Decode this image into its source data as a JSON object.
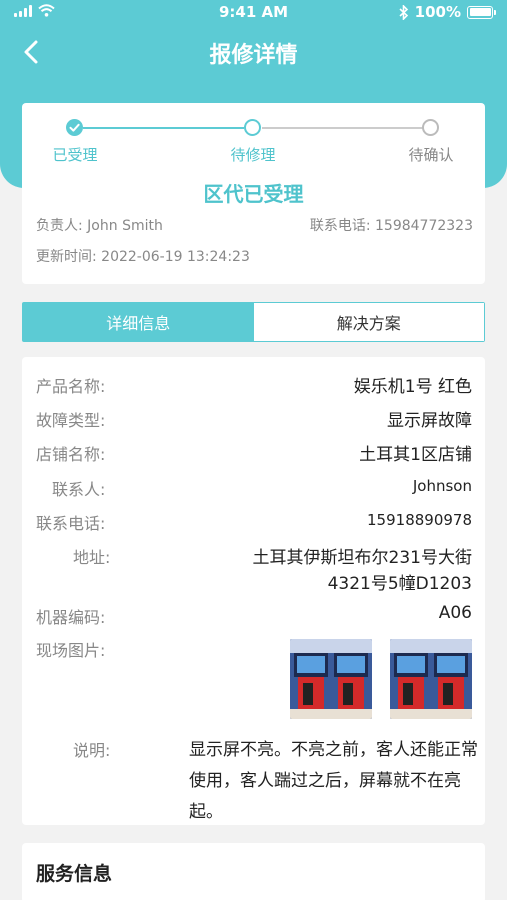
{
  "status_bar": {
    "time": "9:41 AM",
    "battery": "100%"
  },
  "nav": {
    "title": "报修详情"
  },
  "progress": {
    "steps": [
      {
        "label": "已受理",
        "state": "done"
      },
      {
        "label": "待修理",
        "state": "active"
      },
      {
        "label": "待确认",
        "state": "todo"
      }
    ],
    "status_text": "区代已受理",
    "manager_label": "负责人:",
    "manager": "John Smith",
    "phone_label": "联系电话:",
    "phone": "15984772323",
    "updated_label": "更新时间:",
    "updated": "2022-06-19  13:24:23"
  },
  "tabs": [
    {
      "label": "详细信息",
      "active": true
    },
    {
      "label": "解决方案",
      "active": false
    }
  ],
  "details": {
    "product_label": "产品名称:",
    "product": "娱乐机1号 红色",
    "fault_label": "故障类型:",
    "fault": "显示屏故障",
    "store_label": "店铺名称:",
    "store": "土耳其1区店铺",
    "contact_label": "联系人:",
    "contact": "Johnson",
    "contact_phone_label": "联系电话:",
    "contact_phone": "15918890978",
    "address_label": "地址:",
    "address_line1": "土耳其伊斯坦布尔231号大街",
    "address_line2": "4321号5幢D1203",
    "machine_code_label": "机器编码:",
    "machine_code": "A06",
    "photos_label": "现场图片:",
    "note_label": "说明:",
    "note": "显示屏不亮。不亮之前，客人还能正常使用，客人踹过之后，屏幕就不在亮起。"
  },
  "service": {
    "title": "服务信息"
  },
  "colors": {
    "accent": "#5ccbd4",
    "accent_text": "#4fc3cc"
  }
}
